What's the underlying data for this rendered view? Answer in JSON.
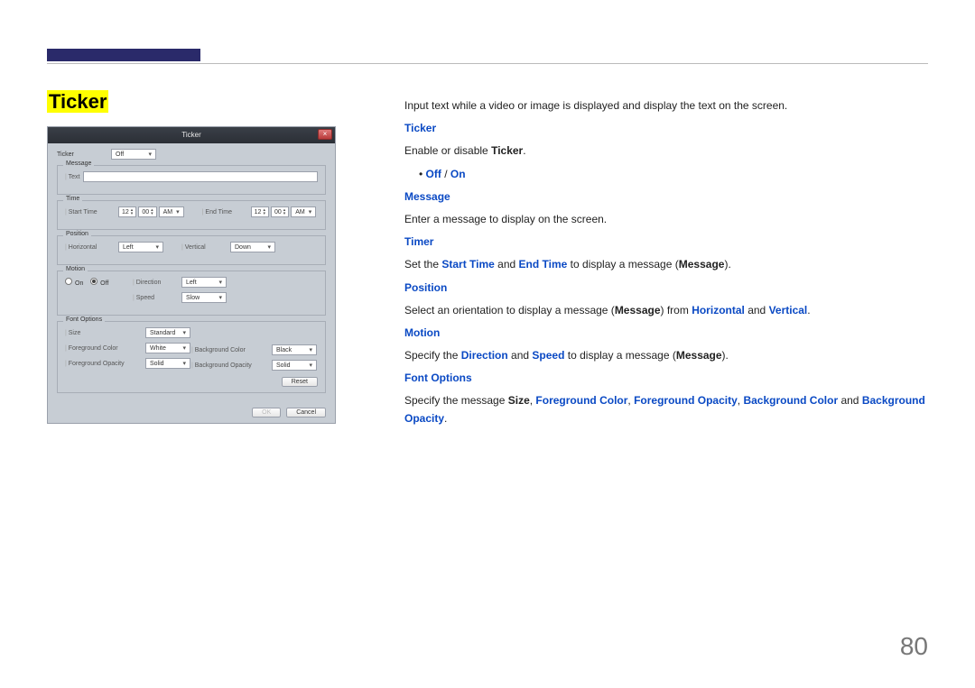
{
  "page": {
    "title": "Ticker",
    "number": "80"
  },
  "dialog": {
    "title": "Ticker",
    "close": "×",
    "labels": {
      "ticker": "Ticker",
      "message": "Message",
      "text": "Text",
      "time": "Time",
      "startTime": "Start Time",
      "endTime": "End Time",
      "position": "Position",
      "horizontal": "Horizontal",
      "vertical": "Vertical",
      "motion": "Motion",
      "on": "On",
      "off": "Off",
      "direction": "Direction",
      "speed": "Speed",
      "fontOptions": "Font Options",
      "size": "Size",
      "fgColor": "Foreground Color",
      "bgColor": "Background Color",
      "fgOpacity": "Foreground Opacity",
      "bgOpacity": "Background Opacity",
      "reset": "Reset",
      "ok": "OK",
      "cancel": "Cancel"
    },
    "values": {
      "ticker": "Off",
      "startHour": "12",
      "startMin": "00",
      "startAmPm": "AM",
      "endHour": "12",
      "endMin": "00",
      "endAmPm": "AM",
      "horizontal": "Left",
      "vertical": "Down",
      "motionOn": false,
      "direction": "Left",
      "speed": "Slow",
      "size": "Standard",
      "fgColor": "White",
      "bgColor": "Black",
      "fgOpacity": "Solid",
      "bgOpacity": "Solid"
    }
  },
  "content": {
    "intro": "Input text while a video or image is displayed and display the text on the screen.",
    "ticker_h": "Ticker",
    "ticker_p1": "Enable or disable ",
    "ticker_b": "Ticker",
    "ticker_p2": ".",
    "offon_off": "Off",
    "offon_sep": " / ",
    "offon_on": "On",
    "message_h": "Message",
    "message_p": "Enter a message to display on the screen.",
    "timer_h": "Timer",
    "timer_p1": "Set the ",
    "timer_b1": "Start Time",
    "timer_p2": " and ",
    "timer_b2": "End Time",
    "timer_p3": " to display a message (",
    "timer_b3": "Message",
    "timer_p4": ").",
    "position_h": "Position",
    "pos_p1": "Select an orientation to display a message (",
    "pos_b1": "Message",
    "pos_p2": ") from ",
    "pos_b2": "Horizontal",
    "pos_p3": " and ",
    "pos_b3": "Vertical",
    "pos_p4": ".",
    "motion_h": "Motion",
    "mot_p1": "Specify the ",
    "mot_b1": "Direction",
    "mot_p2": " and ",
    "mot_b2": "Speed",
    "mot_p3": " to display a message (",
    "mot_b3": "Message",
    "mot_p4": ").",
    "font_h": "Font Options",
    "font_p1": "Specify the message ",
    "font_b1": "Size",
    "font_p2": ", ",
    "font_b2": "Foreground Color",
    "font_p3": ", ",
    "font_b3": "Foreground Opacity",
    "font_p4": ", ",
    "font_b4": "Background Color",
    "font_p5": " and ",
    "font_b5": "Background Opacity",
    "font_p6": "."
  }
}
